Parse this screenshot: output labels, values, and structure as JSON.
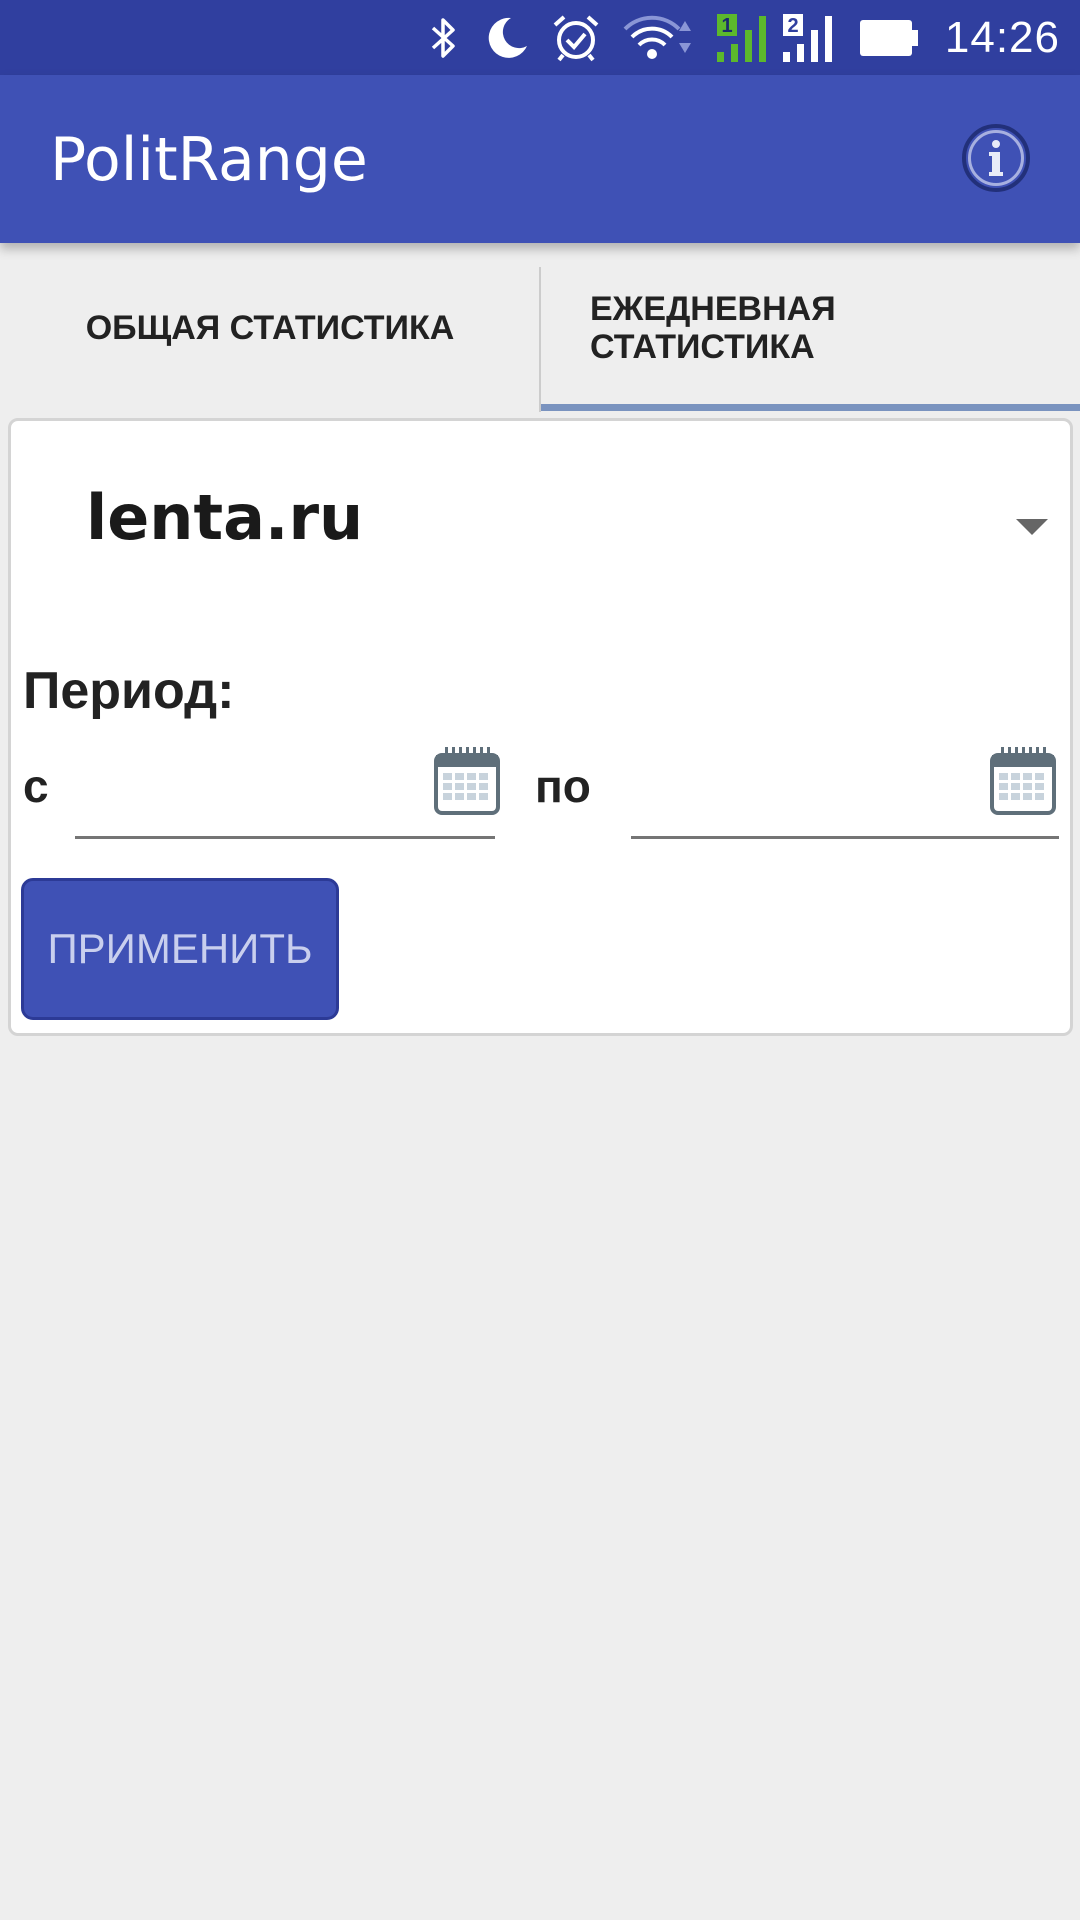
{
  "status_bar": {
    "time": "14:26",
    "icons": [
      "bluetooth-icon",
      "moon-icon",
      "alarm-icon",
      "wifi-icon",
      "signal-sim1-icon",
      "signal-sim2-icon",
      "battery-icon"
    ],
    "sim1_label": "1",
    "sim2_label": "2"
  },
  "app_bar": {
    "title": "PolitRange",
    "info_icon": "info-icon"
  },
  "tabs": [
    {
      "label": "ОБЩАЯ СТАТИСТИКА",
      "selected": false
    },
    {
      "label": "ЕЖЕДНЕВНАЯ СТАТИСТИКА",
      "selected": true
    }
  ],
  "form": {
    "site_selected": "lenta.ru",
    "period_label": "Период:",
    "from_label": "с",
    "to_label": "по",
    "from_value": "",
    "to_value": "",
    "apply_label": "ПРИМЕНИТЬ"
  },
  "colors": {
    "status_bar": "#303f9f",
    "app_bar": "#3f51b5",
    "tab_indicator": "#7a93bf",
    "background": "#eeeeee",
    "button": "#3f51b5",
    "button_text": "#c9cfee"
  }
}
